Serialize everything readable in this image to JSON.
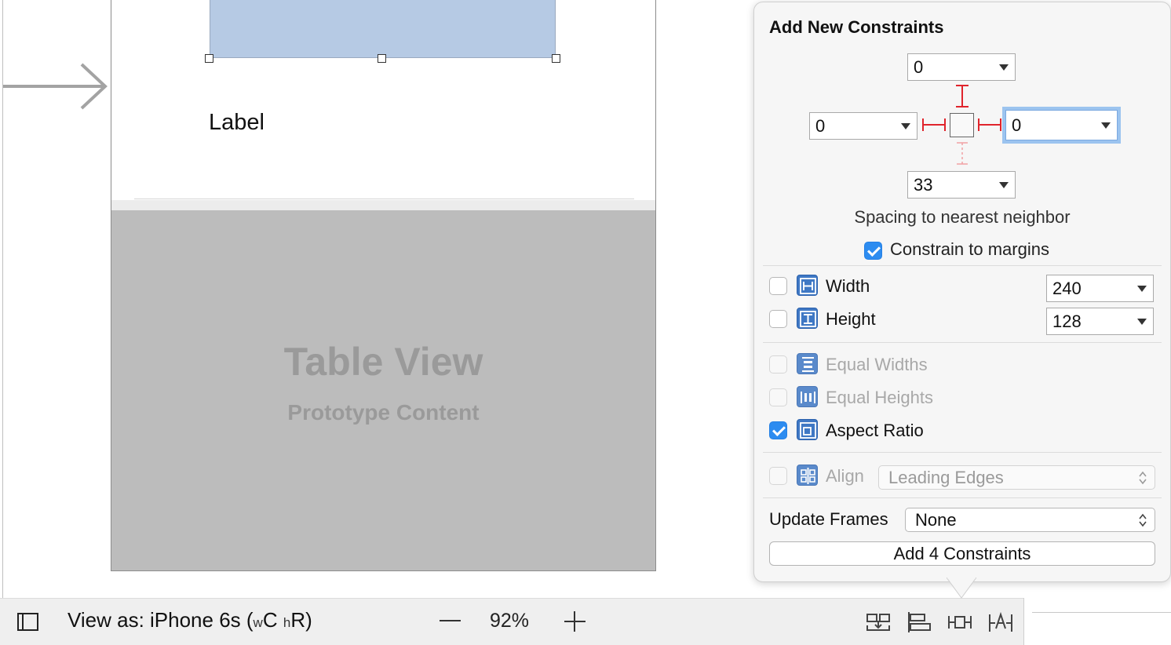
{
  "canvas": {
    "label_text": "Label",
    "table_title": "Table View",
    "table_subtitle": "Prototype Content"
  },
  "bottom_bar": {
    "view_as_prefix": "View as: iPhone 6s (",
    "size_w": "w",
    "size_c": "C",
    "size_h": "h",
    "size_r": "R)",
    "zoom_level": "92%",
    "tools": [
      "embed-in-stack-icon",
      "align-icon",
      "pin-icon",
      "resolve-autolayout-icon"
    ]
  },
  "popover": {
    "title": "Add New Constraints",
    "spacing": {
      "top": "0",
      "left": "0",
      "right": "0",
      "bottom": "33",
      "caption": "Spacing to nearest neighbor"
    },
    "constrain_to_margins": {
      "label": "Constrain to margins",
      "checked": true
    },
    "width": {
      "label": "Width",
      "value": "240",
      "checked": false
    },
    "height": {
      "label": "Height",
      "value": "128",
      "checked": false
    },
    "equal_widths": {
      "label": "Equal Widths",
      "checked": false,
      "enabled": false
    },
    "equal_heights": {
      "label": "Equal Heights",
      "checked": false,
      "enabled": false
    },
    "aspect_ratio": {
      "label": "Aspect Ratio",
      "checked": true
    },
    "align": {
      "label": "Align",
      "value": "Leading Edges",
      "enabled": false
    },
    "update_frames": {
      "label": "Update Frames",
      "value": "None"
    },
    "add_button": "Add 4 Constraints"
  },
  "colors": {
    "accent": "#2d8cf0",
    "constraint_red": "#e0242c",
    "image_view_fill": "#b6cae4",
    "table_view_fill": "#bcbcbc",
    "icon_blue": "#3f78c4"
  }
}
